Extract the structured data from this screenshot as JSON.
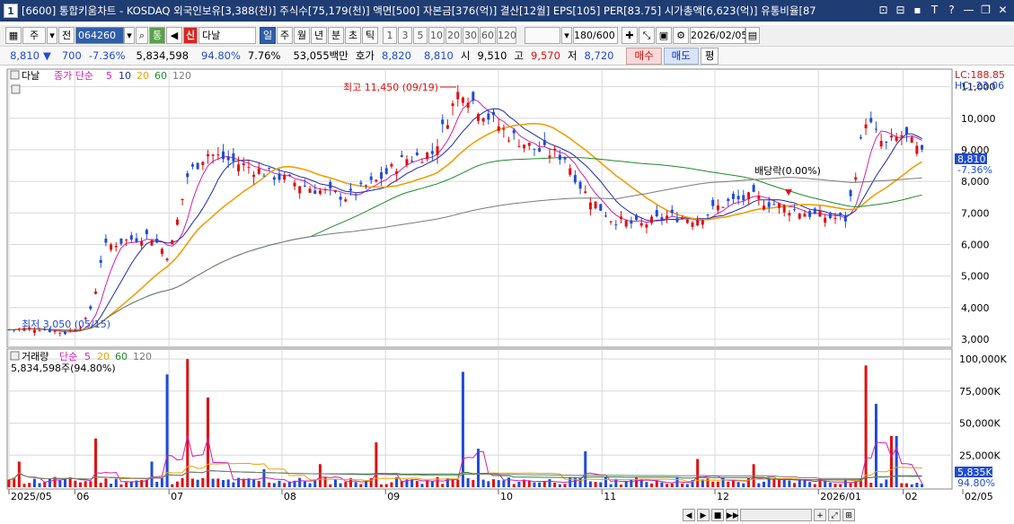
{
  "titlebar": {
    "icon_label": "1",
    "title": "[6600] 통합키움차트 - KOSDAQ 외국인보유[3,388(천)] 주식수[75,179(천)] 액면[500] 자본금[376(억)] 결산[12월] EPS[105] PER[83.75] 시가총액[6,623(억)] 유통비율[87",
    "controls": [
      "⊡",
      "⊟",
      "▪",
      "T",
      "?",
      "—",
      "❐",
      "✕"
    ]
  },
  "toolbar": {
    "period_label": "주",
    "all_label": "전",
    "stock_code": "064260",
    "type_label": "통",
    "sound_label": "◀",
    "credit_label": "신",
    "stock_name": "다날",
    "interval_buttons": [
      "일",
      "주",
      "월",
      "년",
      "분",
      "초",
      "틱"
    ],
    "minute_buttons": [
      "1",
      "3",
      "5",
      "10",
      "20",
      "30",
      "60",
      "120"
    ],
    "data_count": "180/600",
    "date": "2026/02/05"
  },
  "quote": {
    "price": "8,810",
    "arrow": "▼",
    "change": "700",
    "change_pct": "-7.36%",
    "volume": "5,834,598",
    "vol_ratio": "94.80%",
    "turnover": "7.76%",
    "amount": "53,055백만",
    "bid_label": "호가",
    "bid1": "8,820",
    "bid2": "8,810",
    "open_label": "시",
    "open": "9,510",
    "high_label": "고",
    "high": "9,570",
    "low_label": "저",
    "low": "8,720",
    "buy_label": "매수",
    "sell_label": "매도",
    "avg_label": "평"
  },
  "price_panel": {
    "name_label": "다날",
    "ma_title": "종가 단순",
    "ma_periods": [
      "5",
      "10",
      "20",
      "60",
      "120"
    ],
    "ma_colors": [
      "#d01fb0",
      "#1f2aa8",
      "#f0a000",
      "#1f8a2a",
      "#7a7a7a"
    ],
    "lc_label": "LC:188.85",
    "hc_label": "HC:-23.06",
    "last_price_tag": "8,810",
    "last_change_tag": "-7.36%",
    "high_annotation": "최고 11,450 (09/19)",
    "low_annotation": "최저 3,050 (05/15)",
    "dividend_annotation": "배당락(0.00%)",
    "y_ticks": [
      "11,000",
      "10,000",
      "9,000",
      "8,000",
      "7,000",
      "6,000",
      "5,000",
      "4,000",
      "3,000"
    ]
  },
  "volume_panel": {
    "title": "거래량",
    "ma_title": "단순",
    "ma_periods": [
      "5",
      "20",
      "60",
      "120"
    ],
    "ma_colors": [
      "#d01fb0",
      "#f0a000",
      "#1f8a2a",
      "#7a7a7a"
    ],
    "current": "5,834,598주(94.80%)",
    "last_tag": "5,835K",
    "last_pct_tag": "94.80%",
    "y_ticks": [
      "100,000K",
      "75,000K",
      "50,000K",
      "25,000K"
    ]
  },
  "x_axis": {
    "labels": [
      "2025/05",
      "06",
      "07",
      "08",
      "09",
      "10",
      "11",
      "12",
      "2026/01",
      "02",
      "02/05"
    ]
  },
  "colors": {
    "up_candle": "#e01010",
    "down_candle": "#1f4bd6",
    "titlebar_bg": "#1f3d73",
    "grid": "#d8d8d8"
  },
  "bottombar": {
    "icons": [
      "◀",
      "▶",
      "■",
      "▶▶",
      "—",
      "+",
      "⤢",
      "⊞"
    ]
  },
  "chart_data": {
    "type": "candlestick",
    "title": "",
    "period": "2025/05 - 2026/02/05",
    "price_ylim": [
      2800,
      11500
    ],
    "volume_ylim": [
      0,
      105000000
    ],
    "x": [
      "2025/05",
      "06",
      "07",
      "08",
      "09",
      "10",
      "11",
      "12",
      "2026/01",
      "02"
    ],
    "close_points": [
      {
        "t": 0.0,
        "v": 3300
      },
      {
        "t": 0.03,
        "v": 3350
      },
      {
        "t": 0.06,
        "v": 3200
      },
      {
        "t": 0.08,
        "v": 3500
      },
      {
        "t": 0.09,
        "v": 4200
      },
      {
        "t": 0.1,
        "v": 5900
      },
      {
        "t": 0.12,
        "v": 6100
      },
      {
        "t": 0.15,
        "v": 6300
      },
      {
        "t": 0.17,
        "v": 5600
      },
      {
        "t": 0.19,
        "v": 8200
      },
      {
        "t": 0.21,
        "v": 8900
      },
      {
        "t": 0.24,
        "v": 8600
      },
      {
        "t": 0.27,
        "v": 8300
      },
      {
        "t": 0.3,
        "v": 8000
      },
      {
        "t": 0.33,
        "v": 7700
      },
      {
        "t": 0.36,
        "v": 7500
      },
      {
        "t": 0.39,
        "v": 8000
      },
      {
        "t": 0.42,
        "v": 8700
      },
      {
        "t": 0.45,
        "v": 8900
      },
      {
        "t": 0.48,
        "v": 11000
      },
      {
        "t": 0.5,
        "v": 10300
      },
      {
        "t": 0.53,
        "v": 9500
      },
      {
        "t": 0.56,
        "v": 9000
      },
      {
        "t": 0.59,
        "v": 8800
      },
      {
        "t": 0.61,
        "v": 7700
      },
      {
        "t": 0.64,
        "v": 6800
      },
      {
        "t": 0.67,
        "v": 6600
      },
      {
        "t": 0.7,
        "v": 6900
      },
      {
        "t": 0.73,
        "v": 6800
      },
      {
        "t": 0.76,
        "v": 7300
      },
      {
        "t": 0.79,
        "v": 7500
      },
      {
        "t": 0.82,
        "v": 7200
      },
      {
        "t": 0.86,
        "v": 6900
      },
      {
        "t": 0.89,
        "v": 6800
      },
      {
        "t": 0.91,
        "v": 10000
      },
      {
        "t": 0.93,
        "v": 9100
      },
      {
        "t": 0.95,
        "v": 9500
      },
      {
        "t": 0.97,
        "v": 8810
      }
    ],
    "volume_spikes": [
      {
        "t": 0.01,
        "v": 20000000
      },
      {
        "t": 0.05,
        "v": 8000000
      },
      {
        "t": 0.09,
        "v": 38000000
      },
      {
        "t": 0.15,
        "v": 20000000
      },
      {
        "t": 0.17,
        "v": 88000000
      },
      {
        "t": 0.19,
        "v": 100000000
      },
      {
        "t": 0.21,
        "v": 70000000
      },
      {
        "t": 0.27,
        "v": 14000000
      },
      {
        "t": 0.33,
        "v": 18000000
      },
      {
        "t": 0.39,
        "v": 35000000
      },
      {
        "t": 0.48,
        "v": 90000000
      },
      {
        "t": 0.5,
        "v": 30000000
      },
      {
        "t": 0.61,
        "v": 28000000
      },
      {
        "t": 0.73,
        "v": 22000000
      },
      {
        "t": 0.79,
        "v": 18000000
      },
      {
        "t": 0.91,
        "v": 95000000
      },
      {
        "t": 0.92,
        "v": 65000000
      },
      {
        "t": 0.94,
        "v": 40000000
      }
    ]
  }
}
